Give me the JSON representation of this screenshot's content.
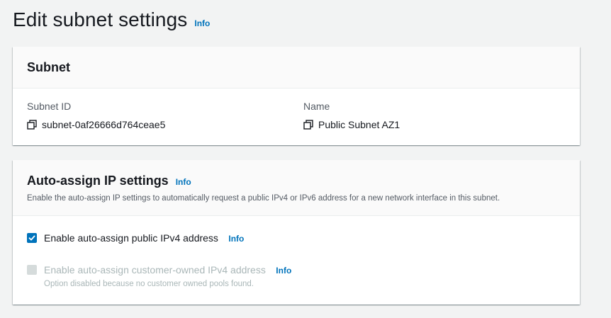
{
  "page": {
    "title": "Edit subnet settings",
    "info": "Info"
  },
  "subnet_panel": {
    "title": "Subnet",
    "subnet_id": {
      "label": "Subnet ID",
      "value": "subnet-0af26666d764ceae5",
      "icon": "copy-icon"
    },
    "name": {
      "label": "Name",
      "value": "Public Subnet AZ1",
      "icon": "copy-icon"
    }
  },
  "auto_assign_panel": {
    "title": "Auto-assign IP settings",
    "info": "Info",
    "description": "Enable the auto-assign IP settings to automatically request a public IPv4 or IPv6 address for a new network interface in this subnet.",
    "options": [
      {
        "label": "Enable auto-assign public IPv4 address",
        "info": "Info",
        "checked": true,
        "disabled": false
      },
      {
        "label": "Enable auto-assign customer-owned IPv4 address",
        "info": "Info",
        "checked": false,
        "disabled": true,
        "note": "Option disabled because no customer owned pools found."
      }
    ]
  },
  "colors": {
    "accent": "#0073bb",
    "background": "#f2f3f3",
    "disabled": "#aab7b8"
  }
}
